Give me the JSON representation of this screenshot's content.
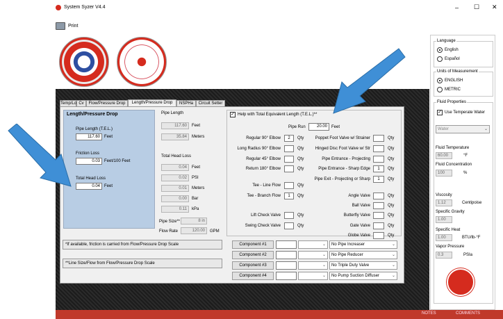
{
  "window": {
    "title": "System Syzer V4.4",
    "minimize": "–",
    "maximize": "☐",
    "close": "✕"
  },
  "toolbar": {
    "print_label": "Print"
  },
  "tabs": [
    "Temp/Load",
    "Cv",
    "Flow/Pressure Drop",
    "Length/Pressure Drop",
    "NSPHa",
    "Circuit Setter"
  ],
  "active_tab": "Length/Pressure Drop",
  "left_panel": {
    "heading": "Length/Pressure Drop",
    "pipe_length_label": "Pipe Length (T.E.L.)",
    "pipe_length_value": "117.60",
    "pipe_length_unit": "Feet",
    "friction_loss_label": "Friction Loss",
    "friction_loss_value": "0.03",
    "friction_loss_unit": "Feet/100 Feet",
    "total_head_loss_label": "Total Head Loss",
    "total_head_loss_value": "0.04",
    "total_head_loss_unit": "Feet"
  },
  "pipe_length_panel": {
    "heading": "Pipe Length",
    "rows": [
      {
        "value": "117.60",
        "unit": "Feet"
      },
      {
        "value": "35.84",
        "unit": "Meters"
      }
    ]
  },
  "total_head_loss_panel": {
    "heading": "Total Head Loss",
    "rows": [
      {
        "value": "0.04",
        "unit": "Feet"
      },
      {
        "value": "0.02",
        "unit": "PSI"
      },
      {
        "value": "0.01",
        "unit": "Meters"
      },
      {
        "value": "0.00",
        "unit": "Bar"
      },
      {
        "value": "0.11",
        "unit": "kPa"
      }
    ]
  },
  "pipe_size": {
    "label": "Pipe Size**",
    "value": "8 in"
  },
  "flow_rate": {
    "label": "Flow Rate",
    "value": "120.00",
    "unit": "GPM"
  },
  "notes": {
    "note1": "*If available, friction is carried from Flow/Pressure Drop Scale",
    "note2": "**Line Size/Flow from Flow/Pressure Drop Scale"
  },
  "tel_help": {
    "checkbox_label": "Help with Total Equivalent Length (T.E.L.)**",
    "pipe_run_label": "Pipe Run",
    "pipe_run_value": "20.00",
    "pipe_run_unit": "Feet",
    "qty_label": "Qty",
    "left_fittings": [
      {
        "label": "Regular 90° Elbow",
        "qty": "2"
      },
      {
        "label": "Long Radius 90° Elbow",
        "qty": ""
      },
      {
        "label": "Regular 45° Elbow",
        "qty": ""
      },
      {
        "label": "Return 180° Elbow",
        "qty": ""
      },
      {
        "label": "Tee - Line Flow",
        "qty": ""
      },
      {
        "label": "Tee - Branch Flow",
        "qty": "1"
      },
      {
        "label": "Lift Check Valve",
        "qty": ""
      },
      {
        "label": "Swing Check Valve",
        "qty": ""
      }
    ],
    "right_fittings": [
      {
        "label": "Poppet Foot Valve w/ Strainer",
        "qty": ""
      },
      {
        "label": "Hinged Disc Foot Valve w/ Str",
        "qty": ""
      },
      {
        "label": "Pipe Entrance - Projecting",
        "qty": ""
      },
      {
        "label": "Pipe Entrance - Sharp Edge",
        "qty": "1"
      },
      {
        "label": "Pipe Exit - Projecting or Sharp",
        "qty": "1"
      },
      {
        "label": "Angle Valve",
        "qty": ""
      },
      {
        "label": "Ball Valve",
        "qty": ""
      },
      {
        "label": "Butterfly Valve",
        "qty": ""
      },
      {
        "label": "Gate Valve",
        "qty": ""
      },
      {
        "label": "Globe Valve",
        "qty": ""
      }
    ]
  },
  "components": [
    {
      "label": "Component #1",
      "option": "No Pipe Increaser"
    },
    {
      "label": "Component #2",
      "option": "No Pipe Reducer"
    },
    {
      "label": "Component #3",
      "option": "No Triple Duty Valve"
    },
    {
      "label": "Component #4",
      "option": "No Pump Suction Diffuser"
    }
  ],
  "sidebar": {
    "language_title": "Language",
    "lang_english": "English",
    "lang_spanish": "Español",
    "units_title": "Units of Measurement",
    "unit_english": "ENGLISH",
    "unit_metric": "METRIC",
    "fluid_title": "Fluid Properties",
    "use_temperate": "Use Temperate Water",
    "fluid_select": "Water",
    "fluid_temp_label": "Fluid Temperature",
    "fluid_temp_value": "60.00",
    "fluid_temp_unit": "°F",
    "fluid_conc_label": "Fluid Concentration",
    "fluid_conc_value": "100",
    "fluid_conc_unit": "%",
    "viscosity_label": "Viscosity",
    "viscosity_value": "1.12",
    "viscosity_unit": "Centipoise",
    "gravity_label": "Specific Gravity",
    "gravity_value": "1.00",
    "heat_label": "Specific Heat",
    "heat_value": "1.00",
    "heat_unit": "BTU/lb-°F",
    "vapor_label": "Vapor Pressure",
    "vapor_value": "0.3",
    "vapor_unit": "PSIa"
  },
  "footer": {
    "notes": "NOTES",
    "comments": "COMMENTS"
  },
  "colors": {
    "accent_arrow": "#3f8fd6",
    "footer_red": "#c0392b",
    "left_panel_blue": "#b8cde4",
    "dark_bg": "#1c1c1c"
  }
}
